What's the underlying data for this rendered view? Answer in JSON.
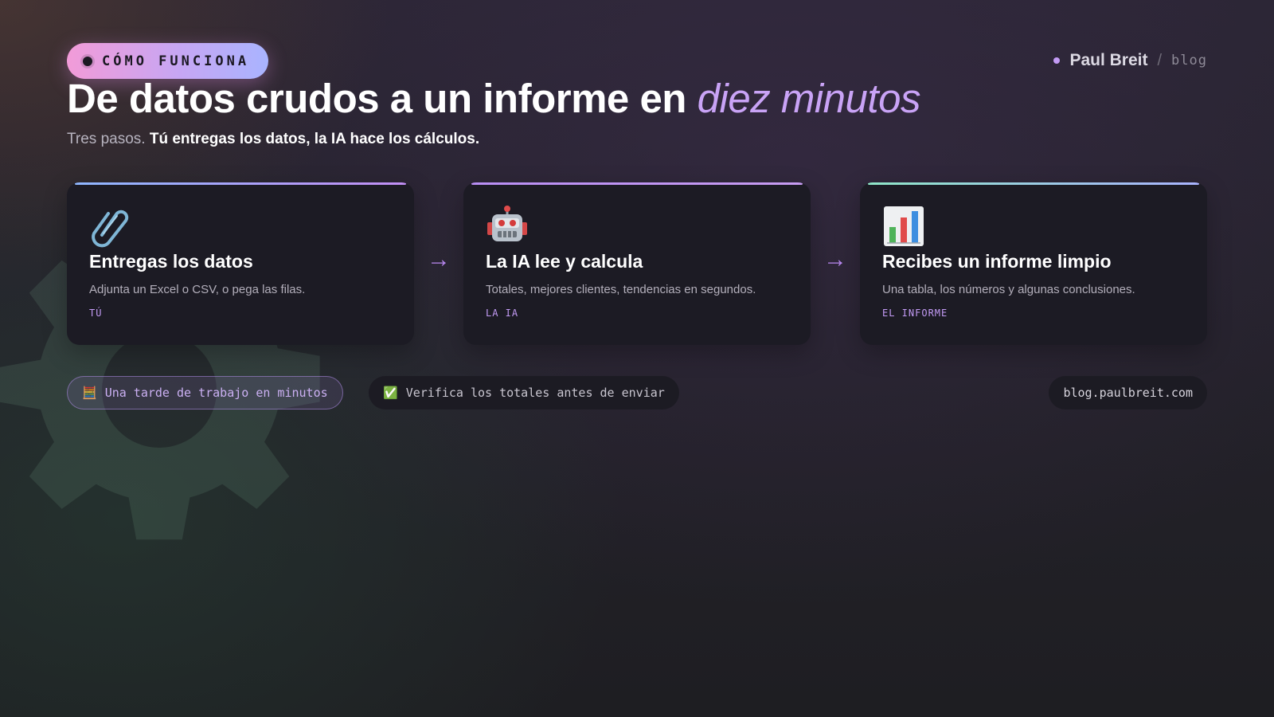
{
  "header": {
    "badge": "CÓMO FUNCIONA",
    "brand_name": "Paul Breit",
    "brand_sep": "/",
    "brand_section": "blog"
  },
  "hero": {
    "title_main": "De datos crudos a un informe en ",
    "title_accent": "diez minutos",
    "subtitle_plain": "Tres pasos. ",
    "subtitle_bold": "Tú entregas los datos, la IA hace los cálculos."
  },
  "steps": [
    {
      "icon": "paperclip-icon",
      "title": "Entregas los datos",
      "description": "Adjunta un Excel o CSV, o pega las filas.",
      "tag": "TÚ",
      "accent": "#9fb0ff"
    },
    {
      "icon": "robot-icon",
      "title": "La IA lee y calcula",
      "description": "Totales, mejores clientes, tendencias en segundos.",
      "tag": "LA IA",
      "accent": "#c28ff5"
    },
    {
      "icon": "bar-chart-icon",
      "title": "Recibes un informe limpio",
      "description": "Una tabla, los números y algunas conclusiones.",
      "tag": "EL INFORME",
      "accent": "#8fe6c8"
    }
  ],
  "arrows": [
    "→",
    "→"
  ],
  "footer": {
    "chip_time_icon": "🧮",
    "chip_time": "Una tarde de trabajo en minutos",
    "chip_check_icon": "✅",
    "chip_check": "Verifica los totales antes de enviar",
    "url": "blog.paulbreit.com"
  },
  "colors": {
    "accent_purple": "#c9a3f6",
    "badge_gradient": [
      "#f29bd8",
      "#c7a6f3",
      "#a9b4ff"
    ],
    "card_bg": "#1c1b24"
  }
}
